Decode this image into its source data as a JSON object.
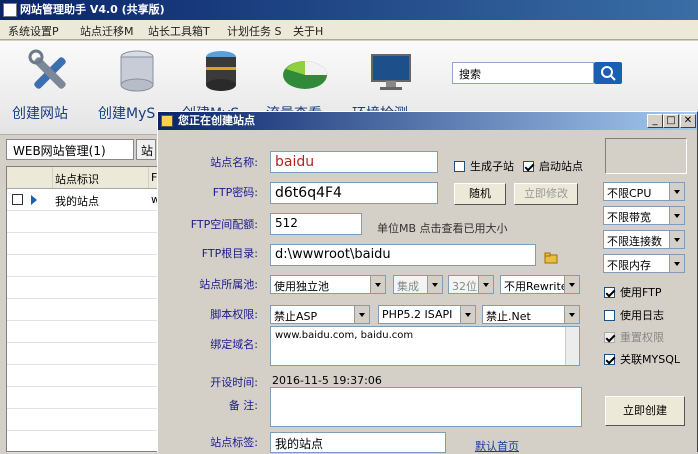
{
  "window": {
    "title": "网站管理助手 V4.0 (共享版)"
  },
  "menu": [
    "系统设置P",
    "站点迁移M",
    "站长工具箱T",
    "计划任务 S",
    "关于H"
  ],
  "toolbar": {
    "buttons": [
      {
        "label": "创建网站",
        "icon": "tools-icon"
      },
      {
        "label": "创建MyS",
        "icon": "database-icon"
      },
      {
        "label": "创建MyS",
        "icon": "server-icon"
      },
      {
        "label": "流量查看",
        "icon": "chart-icon"
      },
      {
        "label": "环境检测",
        "icon": "monitor-icon"
      }
    ],
    "search_value": "搜索"
  },
  "left_panel": {
    "tab_label": "WEB网站管理(1)",
    "tab2_label": "站",
    "header": "站点标识",
    "header2": "F",
    "rows": [
      {
        "name": "我的站点",
        "extra": "w"
      }
    ]
  },
  "dialog": {
    "title": "您正在创建站点",
    "site_name_label": "站点名称:",
    "site_name": "baidu",
    "create_subsite_label": "生成子站",
    "enable_site_label": "启动站点",
    "ftp_password_label": "FTP密码:",
    "ftp_password": "d6t6q4F4",
    "random_button": "随机",
    "modify_button": "立即修改",
    "ftp_quota_label": "FTP空间配额:",
    "ftp_quota": "512",
    "quota_hint": "单位MB 点击查看已用大小",
    "ftp_root_label": "FTP根目录:",
    "ftp_root": "d:\\wwwroot\\baidu",
    "pool_label": "站点所属池:",
    "pool_select": "使用独立池",
    "pool_mode": "集成",
    "pool_bits": "32位",
    "rewrite_select": "不用Rewrite",
    "script_label": "脚本权限:",
    "asp_select": "禁止ASP",
    "php_select": "PHP5.2 ISAPI",
    "net_select": "禁止.Net",
    "domain_label": "绑定域名:",
    "domain_value": "www.baidu.com, baidu.com",
    "open_time_label": "开设时间:",
    "open_time": "2016-11-5 19:37:06",
    "remark_label": "备 注:",
    "remark_value": "",
    "tag_label": "站点标签:",
    "tag_value": "我的站点",
    "default_home_link": "默认首页",
    "right_selects": [
      "不限CPU",
      "不限带宽",
      "不限连接数",
      "不限内存"
    ],
    "right_checks": [
      {
        "label": "使用FTP",
        "checked": true,
        "disabled": false
      },
      {
        "label": "使用日志",
        "checked": false,
        "disabled": false
      },
      {
        "label": "重置权限",
        "checked": true,
        "disabled": true
      },
      {
        "label": "关联MYSQL",
        "checked": true,
        "disabled": false
      }
    ],
    "create_button": "立即创建",
    "colors": {
      "site_name": "#b22222",
      "label": "#1a1a8a",
      "title_bar": "#0a246a"
    }
  }
}
